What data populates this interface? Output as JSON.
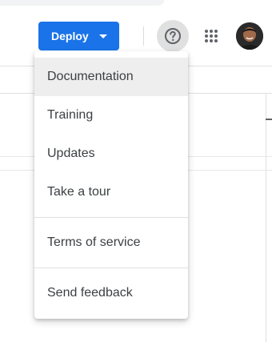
{
  "header": {
    "deploy_label": "Deploy"
  },
  "help_menu": {
    "items": [
      {
        "label": "Documentation"
      },
      {
        "label": "Training"
      },
      {
        "label": "Updates"
      },
      {
        "label": "Take a tour"
      },
      {
        "label": "Terms of service"
      },
      {
        "label": "Send feedback"
      }
    ]
  },
  "colors": {
    "accent": "#1a73e8",
    "menu_highlight": "#eeeeee"
  },
  "icons": [
    "chevron-down-icon",
    "help-circle-icon",
    "apps-grid-icon"
  ]
}
